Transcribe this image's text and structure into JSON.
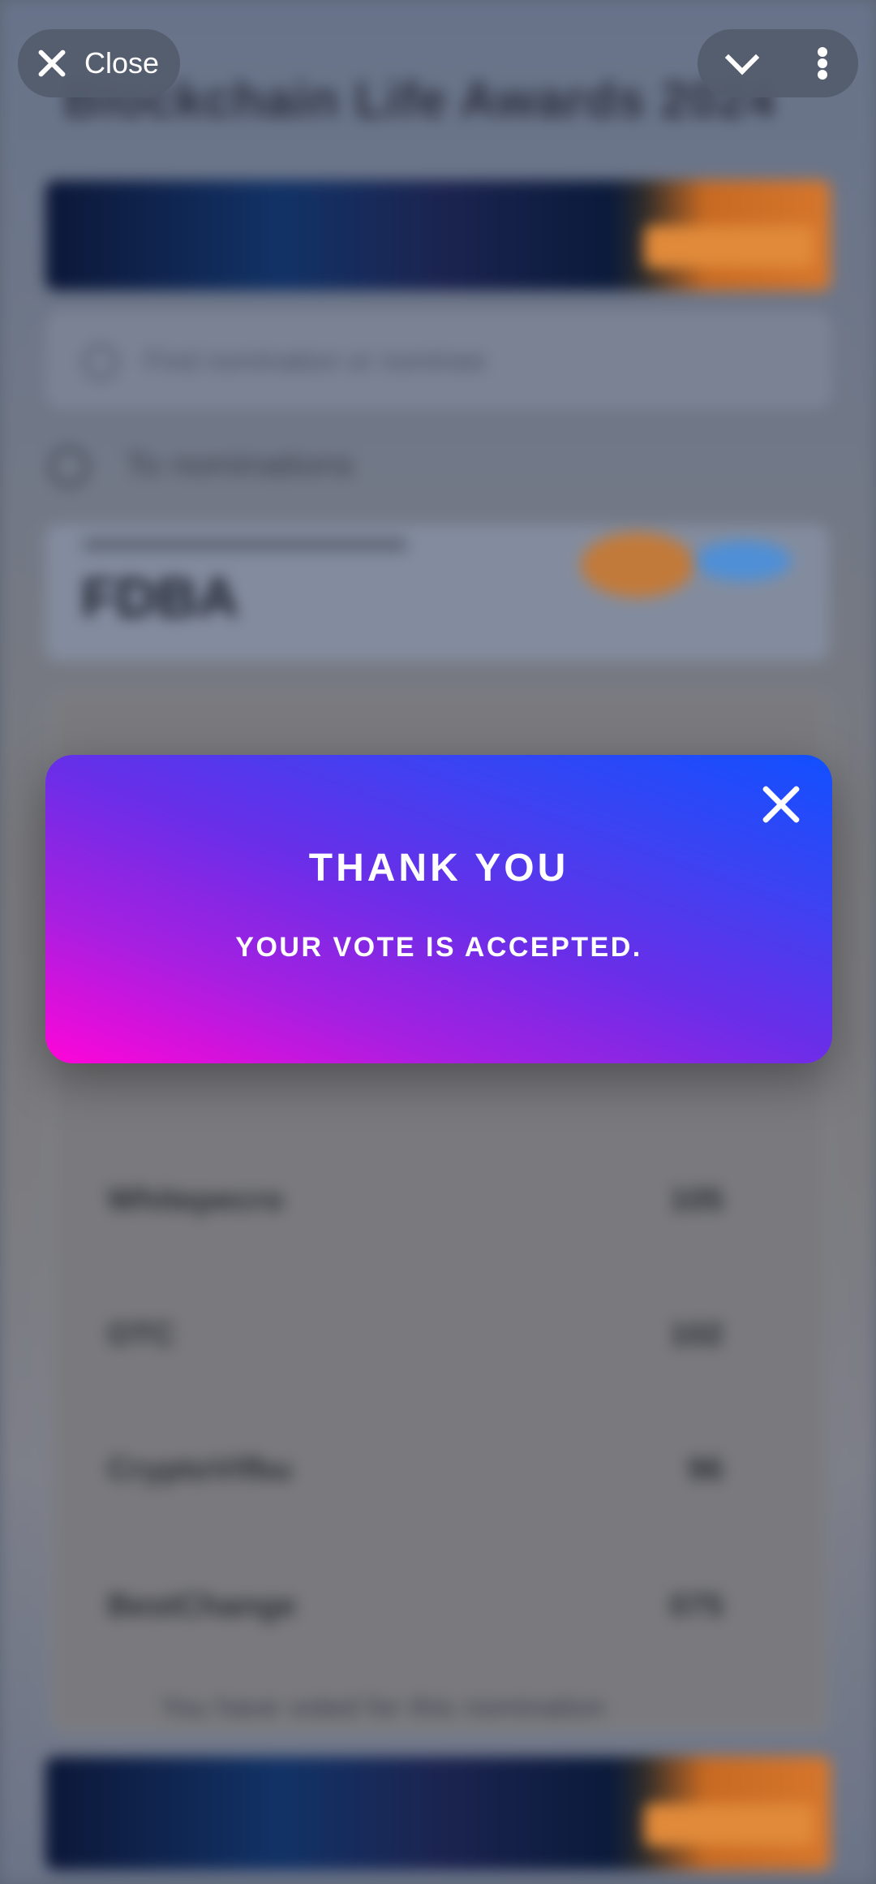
{
  "browser": {
    "close_label": "Close",
    "icons": [
      "close-icon",
      "chevron-down-icon",
      "more-vert-icon"
    ]
  },
  "background": {
    "title": "Blockchain Life Awards 2024",
    "search_placeholder": "Find nomination or nominee",
    "back_label": "To nominations",
    "nomination_name": "FDBA",
    "rows": [
      {
        "name": "Whitepecro",
        "value": "105"
      },
      {
        "name": "OTC",
        "value": "102"
      },
      {
        "name": "CryptoVifbu",
        "value": "96"
      },
      {
        "name": "BestChange",
        "value": "075"
      }
    ],
    "footnote": "You have voted for this nomination"
  },
  "modal": {
    "title": "THANK YOU",
    "message": "YOUR VOTE IS ACCEPTED.",
    "close_icon": "close-icon",
    "gradient_colors": [
      "#1150ff",
      "#6a2ee8",
      "#ff05d8"
    ]
  }
}
